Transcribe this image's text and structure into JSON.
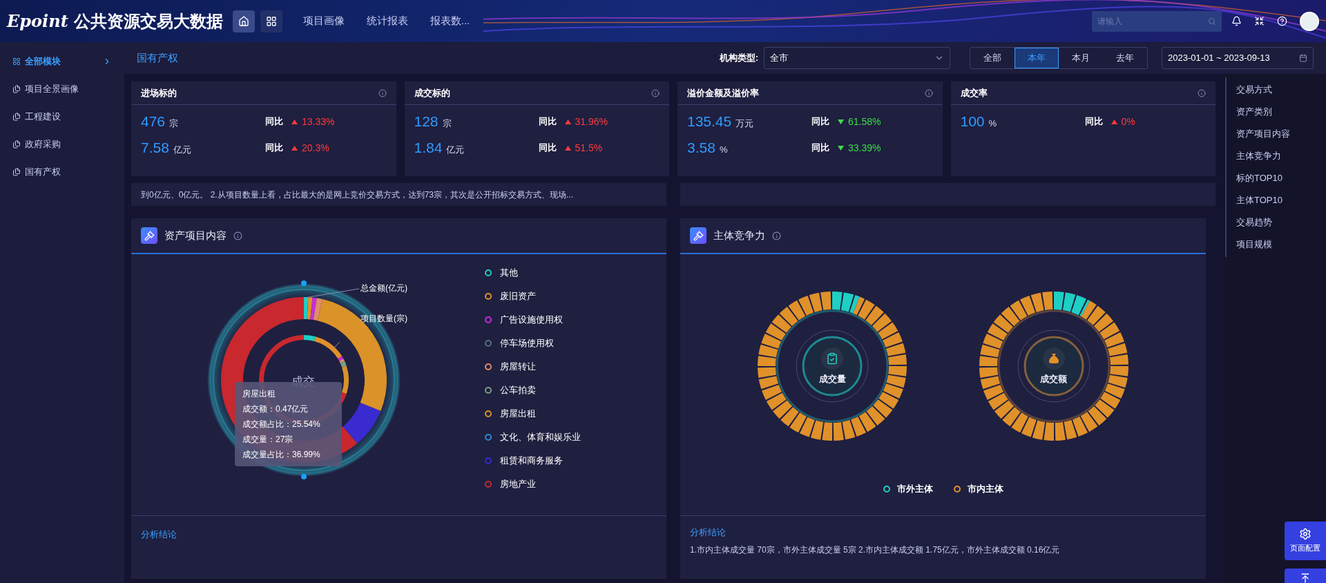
{
  "header": {
    "logo": "Epoint",
    "title": "公共资源交易大数据",
    "nav": [
      "项目画像",
      "统计报表",
      "报表数..."
    ],
    "search": {
      "placeholder": "请输入"
    }
  },
  "sidebar": {
    "items": [
      {
        "label": "全部模块",
        "selected": true,
        "kind": "group"
      },
      {
        "label": "项目全景画像",
        "selected": false,
        "kind": "item"
      },
      {
        "label": "工程建设",
        "selected": false,
        "kind": "item"
      },
      {
        "label": "政府采购",
        "selected": false,
        "kind": "item"
      },
      {
        "label": "国有产权",
        "selected": false,
        "kind": "item"
      }
    ]
  },
  "toolbar": {
    "breadcrumb": "国有产权",
    "filter_label": "机构类型:",
    "filter_value": "全市",
    "periods": [
      {
        "label": "全部",
        "selected": false
      },
      {
        "label": "本年",
        "selected": true
      },
      {
        "label": "本月",
        "selected": false
      },
      {
        "label": "去年",
        "selected": false
      }
    ],
    "date_range": "2023-01-01 ~ 2023-09-13"
  },
  "kpis": [
    {
      "title": "进场标的",
      "rows": [
        {
          "value": "476",
          "unit": "宗",
          "compare_label": "同比",
          "change": "13.33%",
          "increase": true
        },
        {
          "value": "7.58",
          "unit": "亿元",
          "compare_label": "同比",
          "change": "20.3%",
          "increase": true
        }
      ]
    },
    {
      "title": "成交标的",
      "rows": [
        {
          "value": "128",
          "unit": "宗",
          "compare_label": "同比",
          "change": "31.96%",
          "increase": true
        },
        {
          "value": "1.84",
          "unit": "亿元",
          "compare_label": "同比",
          "change": "51.5%",
          "increase": true
        }
      ]
    },
    {
      "title": "溢价金额及溢价率",
      "rows": [
        {
          "value": "135.45",
          "unit": "万元",
          "compare_label": "同比",
          "change": "61.58%",
          "increase": false
        },
        {
          "value": "3.58",
          "unit": "%",
          "compare_label": "同比",
          "change": "33.39%",
          "increase": false
        }
      ]
    },
    {
      "title": "成交率",
      "rows": [
        {
          "value": "100",
          "unit": "%",
          "compare_label": "同比",
          "change": "0%",
          "increase": true
        }
      ]
    }
  ],
  "summary": "到0亿元、0亿元。 2.从项目数量上看，占比最大的是网上竞价交易方式，达到73宗，其次是公开招标交易方式、现场...",
  "asset_panel": {
    "title": "资产项目内容",
    "center_label": "成交",
    "outer_label": "总金额(亿元)",
    "inner_label": "项目数量(宗)",
    "legend": [
      {
        "label": "其他",
        "color": "#1ecfc4"
      },
      {
        "label": "废旧资产",
        "color": "#e0912a"
      },
      {
        "label": "广告设施使用权",
        "color": "#c42fd8"
      },
      {
        "label": "停车场使用权",
        "color": "#56707f"
      },
      {
        "label": "房屋转让",
        "color": "#e08c6a"
      },
      {
        "label": "公车拍卖",
        "color": "#7a9f80"
      },
      {
        "label": "房屋出租",
        "color": "#db9228"
      },
      {
        "label": "文化、体育和娱乐业",
        "color": "#2f86d8"
      },
      {
        "label": "租赁和商务服务",
        "color": "#3a2bd0"
      },
      {
        "label": "房地产业",
        "color": "#c8282e"
      }
    ],
    "tooltip": {
      "title": "房屋出租",
      "lines": [
        "成交额：0.47亿元",
        "成交额占比：25.54%",
        "成交量：27宗",
        "成交量占比：36.99%"
      ]
    },
    "conclusion_label": "分析结论"
  },
  "subject_panel": {
    "title": "主体竞争力",
    "rings": [
      {
        "label": "成交量",
        "kind": "count"
      },
      {
        "label": "成交额",
        "kind": "amount"
      }
    ],
    "legend": [
      {
        "label": "市外主体",
        "color": "#1ecfc4"
      },
      {
        "label": "市内主体",
        "color": "#e0912a"
      }
    ],
    "conclusion_label": "分析结论",
    "conclusion": "1.市内主体成交量 70宗，市外主体成交量 5宗 2.市内主体成交额 1.75亿元，市外主体成交额 0.16亿元"
  },
  "anchor_nav": [
    "交易方式",
    "资产类别",
    "资产项目内容",
    "主体竞争力",
    "标的TOP10",
    "主体TOP10",
    "交易趋势",
    "项目规模"
  ],
  "page_config_button": "页面配置"
}
